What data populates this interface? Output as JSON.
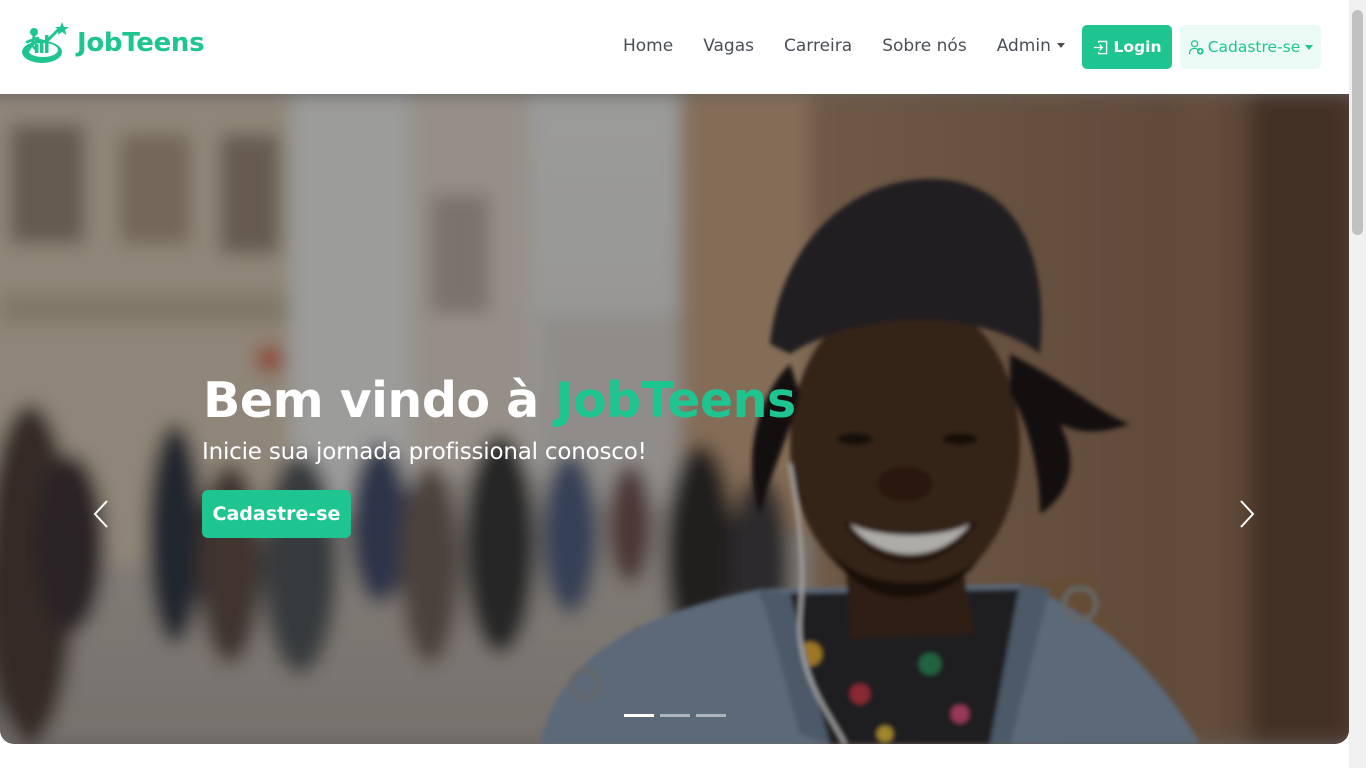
{
  "brand": {
    "name": "JobTeens",
    "logo_icon": "jobteens-logo-icon",
    "color": "#1fc591"
  },
  "nav": {
    "links": [
      "Home",
      "Vagas",
      "Carreira",
      "Sobre nós"
    ],
    "admin_label": "Admin",
    "login_label": "Login",
    "login_icon": "login-icon",
    "register_label": "Cadastre-se",
    "register_icon": "user-add-icon"
  },
  "hero": {
    "title_prefix": "Bem vindo à",
    "title_accent": "JobTeens",
    "subtitle": "Inicie sua jornada profissional conosco!",
    "cta_label": "Cadastre-se",
    "prev_icon": "chevron-left-icon",
    "next_icon": "chevron-right-icon",
    "slide_count": 3,
    "active_slide": 1
  },
  "colors": {
    "accent": "#1fc591",
    "nav_text": "#4a4f55",
    "register_bg": "#ecfaf5"
  }
}
